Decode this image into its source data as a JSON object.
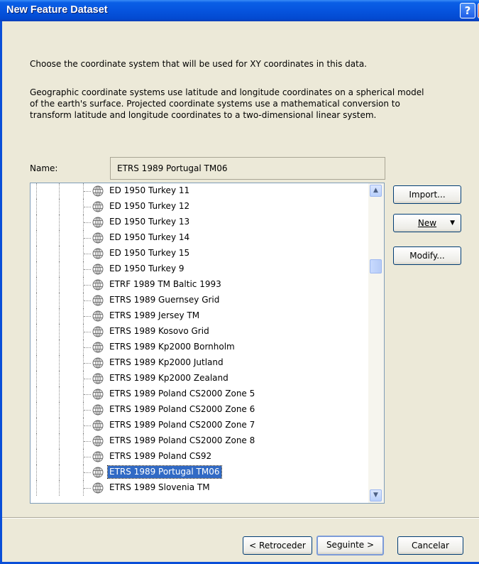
{
  "window": {
    "title": "New Feature Dataset",
    "help_symbol": "?",
    "close_symbol": "✕"
  },
  "intro": {
    "line1": "Choose the coordinate system that will be used for XY coordinates in this data.",
    "para2_l1": "Geographic coordinate systems use latitude and longitude coordinates on a spherical model",
    "para2_l2": "of the earth's surface. Projected coordinate systems use a mathematical conversion to",
    "para2_l3": "transform latitude and longitude coordinates to a two-dimensional linear system."
  },
  "name_field": {
    "label": "Name:",
    "value": "ETRS 1989 Portugal TM06"
  },
  "tree": {
    "items": [
      {
        "label": "ED 1950 Turkey 11",
        "icon": "globe-icon"
      },
      {
        "label": "ED 1950 Turkey 12",
        "icon": "globe-icon"
      },
      {
        "label": "ED 1950 Turkey 13",
        "icon": "globe-icon"
      },
      {
        "label": "ED 1950 Turkey 14",
        "icon": "globe-icon"
      },
      {
        "label": "ED 1950 Turkey 15",
        "icon": "globe-icon"
      },
      {
        "label": "ED 1950 Turkey 9",
        "icon": "globe-icon"
      },
      {
        "label": "ETRF 1989 TM Baltic 1993",
        "icon": "globe-icon"
      },
      {
        "label": "ETRS 1989 Guernsey Grid",
        "icon": "globe-icon"
      },
      {
        "label": "ETRS 1989 Jersey TM",
        "icon": "globe-icon"
      },
      {
        "label": "ETRS 1989 Kosovo Grid",
        "icon": "globe-icon"
      },
      {
        "label": "ETRS 1989 Kp2000 Bornholm",
        "icon": "globe-icon"
      },
      {
        "label": "ETRS 1989 Kp2000 Jutland",
        "icon": "globe-icon"
      },
      {
        "label": "ETRS 1989 Kp2000 Zealand",
        "icon": "globe-icon"
      },
      {
        "label": "ETRS 1989 Poland CS2000 Zone 5",
        "icon": "globe-icon"
      },
      {
        "label": "ETRS 1989 Poland CS2000 Zone 6",
        "icon": "globe-icon"
      },
      {
        "label": "ETRS 1989 Poland CS2000 Zone 7",
        "icon": "globe-icon"
      },
      {
        "label": "ETRS 1989 Poland CS2000 Zone 8",
        "icon": "globe-icon"
      },
      {
        "label": "ETRS 1989 Poland CS92",
        "icon": "globe-icon"
      },
      {
        "label": "ETRS 1989 Portugal TM06",
        "icon": "globe-icon",
        "selected": true
      },
      {
        "label": "ETRS 1989 Slovenia TM",
        "icon": "globe-icon"
      }
    ]
  },
  "side_buttons": {
    "import": "Import...",
    "new": "New",
    "new_arrow": "▼",
    "modify": "Modify..."
  },
  "scroll_arrows": {
    "up": "▲",
    "down": "▼"
  },
  "footer": {
    "back": "< Retroceder",
    "next": "Seguinte >",
    "cancel": "Cancelar"
  },
  "colors": {
    "selection": "#316ac5",
    "title_bar": "#0654de",
    "dialog_bg": "#ece9d8"
  }
}
